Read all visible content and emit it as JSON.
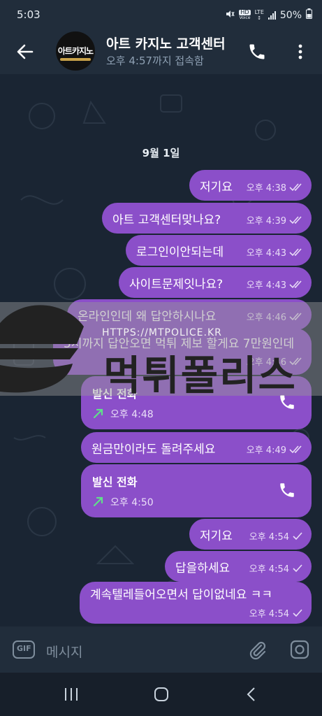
{
  "status_bar": {
    "time": "5:03",
    "hd_label": "HD",
    "voice_label": "Voice",
    "lte_label": "LTE",
    "battery": "50%"
  },
  "header": {
    "avatar_text": "아트카지노",
    "title": "아트 카지노 고객센터",
    "subtitle": "오후 4:57까지 접속함"
  },
  "date_label": "9월 1일",
  "messages": [
    {
      "text": "저기요",
      "time": "오후 4:38",
      "status": "read"
    },
    {
      "text": "아트 고객센터맞나요?",
      "time": "오후 4:39",
      "status": "read"
    },
    {
      "text": "로그인이안되는데",
      "time": "오후 4:43",
      "status": "read"
    },
    {
      "text": "사이트문제잇나요?",
      "time": "오후 4:43",
      "status": "read"
    },
    {
      "text": "온라인인데 왜 답안하시나요",
      "time": "오후 4:46",
      "status": "read"
    },
    {
      "text": "5시까지 답안오면 먹튀 제보 할게요 7만원인데",
      "time": "오후 4:46",
      "status": "read"
    },
    {
      "call_title": "발신 전화",
      "time": "오후 4:48"
    },
    {
      "text": "원금만이라도 돌려주세요",
      "time": "오후 4:49",
      "status": "read"
    },
    {
      "call_title": "발신 전화",
      "time": "오후 4:50"
    },
    {
      "text": "저기요",
      "time": "오후 4:54",
      "status": "sent"
    },
    {
      "text": "답을하세요",
      "time": "오후 4:54",
      "status": "sent"
    },
    {
      "text": "계속텔레들어오면서 답이없네요 ㅋㅋ",
      "time": "오후 4:54",
      "status": "sent"
    }
  ],
  "watermark": {
    "url": "HTTPS://MTPOLICE.KR",
    "name": "먹튀폴리스"
  },
  "input": {
    "gif_label": "GIF",
    "placeholder": "메시지"
  },
  "colors": {
    "bubble": "#8b4fc9",
    "background": "#1a2533",
    "bar": "#212d3b"
  }
}
